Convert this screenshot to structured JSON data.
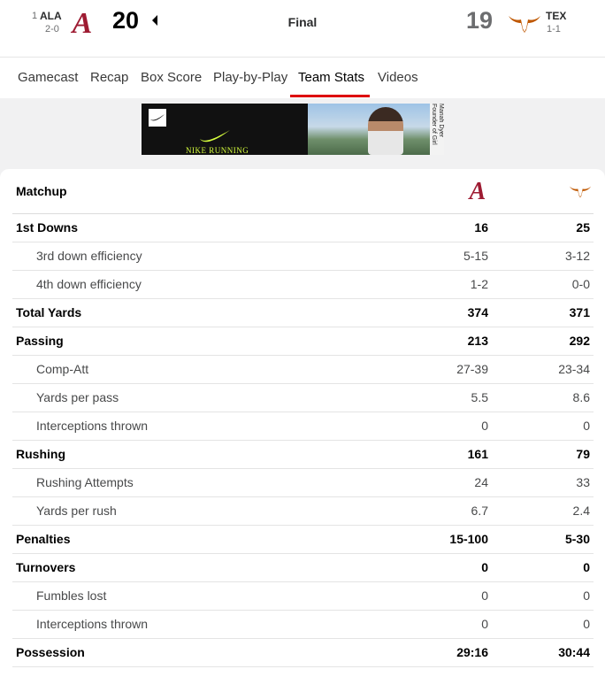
{
  "header": {
    "away": {
      "rank": "1",
      "abbr": "ALA",
      "record": "2-0",
      "score": "20",
      "color": "#9e1b32"
    },
    "home": {
      "abbr": "TEX",
      "record": "1-1",
      "score": "19",
      "color": "#bf5700"
    },
    "status": "Final"
  },
  "nav": {
    "tabs": [
      "Gamecast",
      "Recap",
      "Box Score",
      "Play-by-Play",
      "Team Stats",
      "Videos"
    ],
    "active": "Team Stats"
  },
  "ad": {
    "text": "NIKE RUNNING",
    "side_text": "Mariah Dyer Founder of Girl Gone"
  },
  "stats": {
    "title": "Matchup",
    "rows": [
      {
        "label": "1st Downs",
        "ala": "16",
        "tex": "25",
        "type": "main"
      },
      {
        "label": "3rd down efficiency",
        "ala": "5-15",
        "tex": "3-12",
        "type": "sub"
      },
      {
        "label": "4th down efficiency",
        "ala": "1-2",
        "tex": "0-0",
        "type": "sub"
      },
      {
        "label": "Total Yards",
        "ala": "374",
        "tex": "371",
        "type": "main"
      },
      {
        "label": "Passing",
        "ala": "213",
        "tex": "292",
        "type": "main"
      },
      {
        "label": "Comp-Att",
        "ala": "27-39",
        "tex": "23-34",
        "type": "sub"
      },
      {
        "label": "Yards per pass",
        "ala": "5.5",
        "tex": "8.6",
        "type": "sub"
      },
      {
        "label": "Interceptions thrown",
        "ala": "0",
        "tex": "0",
        "type": "sub"
      },
      {
        "label": "Rushing",
        "ala": "161",
        "tex": "79",
        "type": "main"
      },
      {
        "label": "Rushing Attempts",
        "ala": "24",
        "tex": "33",
        "type": "sub"
      },
      {
        "label": "Yards per rush",
        "ala": "6.7",
        "tex": "2.4",
        "type": "sub"
      },
      {
        "label": "Penalties",
        "ala": "15-100",
        "tex": "5-30",
        "type": "main"
      },
      {
        "label": "Turnovers",
        "ala": "0",
        "tex": "0",
        "type": "main"
      },
      {
        "label": "Fumbles lost",
        "ala": "0",
        "tex": "0",
        "type": "sub"
      },
      {
        "label": "Interceptions thrown",
        "ala": "0",
        "tex": "0",
        "type": "sub"
      },
      {
        "label": "Possession",
        "ala": "29:16",
        "tex": "30:44",
        "type": "main"
      }
    ]
  }
}
